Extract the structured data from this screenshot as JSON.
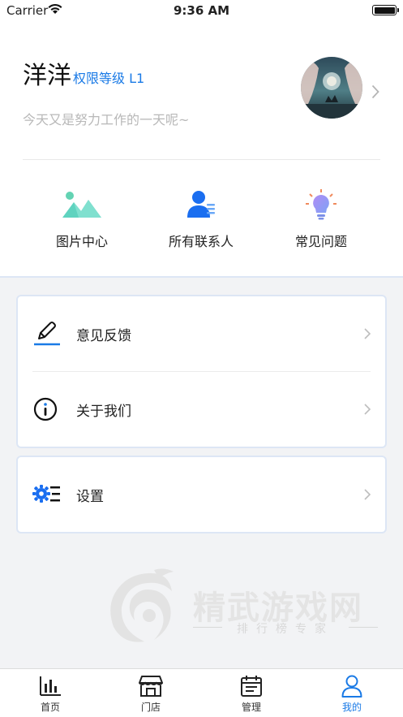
{
  "status_bar": {
    "carrier": "Carrier",
    "time": "9:36 AM"
  },
  "profile": {
    "name": "洋洋",
    "level": "权限等级 L1",
    "motto": "今天又是努力工作的一天呢~"
  },
  "quick_actions": [
    {
      "label": "图片中心",
      "icon": "image-icon"
    },
    {
      "label": "所有联系人",
      "icon": "contacts-icon"
    },
    {
      "label": "常见问题",
      "icon": "lightbulb-icon"
    }
  ],
  "menu": {
    "feedback": "意见反馈",
    "about": "关于我们",
    "settings": "设置"
  },
  "watermark": {
    "title": "精武游戏网",
    "subtitle": "排行榜专家"
  },
  "tabs": [
    {
      "label": "首页",
      "icon": "chart-icon"
    },
    {
      "label": "门店",
      "icon": "store-icon"
    },
    {
      "label": "管理",
      "icon": "calendar-icon"
    },
    {
      "label": "我的",
      "icon": "person-icon",
      "active": true
    }
  ],
  "colors": {
    "accent": "#1a7ae6",
    "background": "#f2f3f5",
    "card_border": "#dde6f5"
  }
}
